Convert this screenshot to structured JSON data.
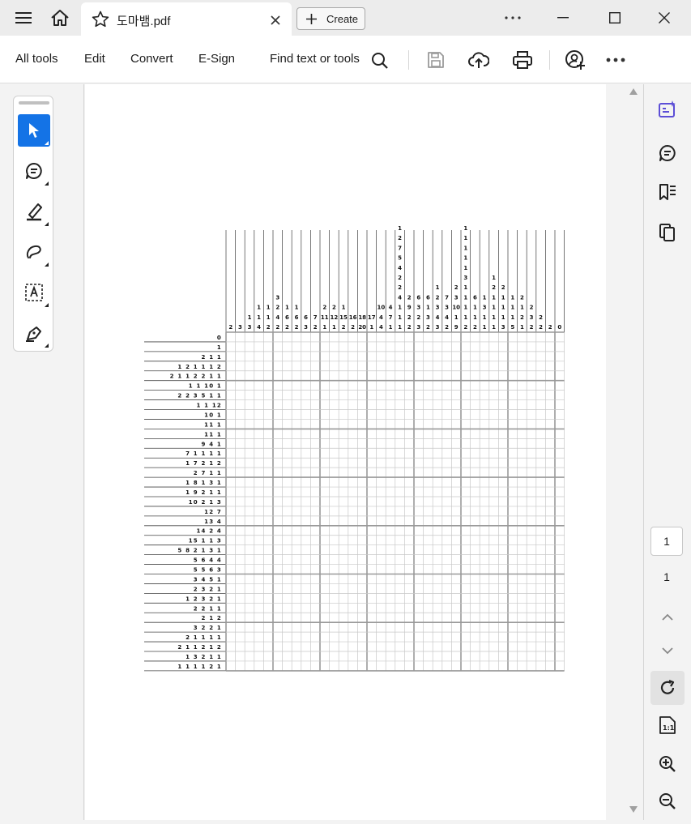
{
  "titlebar": {
    "tab_title": "도마뱀.pdf",
    "create_label": "Create"
  },
  "toolbar": {
    "menu": [
      "All tools",
      "Edit",
      "Convert",
      "E-Sign"
    ],
    "search_label": "Find text or tools"
  },
  "page_nav": {
    "current": "1",
    "total": "1"
  },
  "puzzle": {
    "col_clues": [
      [
        "2"
      ],
      [
        "3"
      ],
      [
        "1",
        "3"
      ],
      [
        "1",
        "1",
        "4"
      ],
      [
        "1",
        "1",
        "2"
      ],
      [
        "3",
        "2",
        "4",
        "2"
      ],
      [
        "1",
        "6",
        "2"
      ],
      [
        "1",
        "6",
        "2"
      ],
      [
        "6",
        "3"
      ],
      [
        "7",
        "2"
      ],
      [
        "2",
        "11",
        "1"
      ],
      [
        "2",
        "12",
        "1"
      ],
      [
        "1",
        "15",
        "2"
      ],
      [
        "16",
        "2"
      ],
      [
        "18",
        "20"
      ],
      [
        "17",
        "1"
      ],
      [
        "10",
        "4",
        "4"
      ],
      [
        "4",
        "7",
        "1"
      ],
      [
        "1",
        "2",
        "7",
        "5",
        "4",
        "2",
        "2",
        "4",
        "1",
        "1",
        "1"
      ],
      [
        "2",
        "9",
        "2",
        "2"
      ],
      [
        "6",
        "3",
        "2",
        "3"
      ],
      [
        "6",
        "1",
        "3",
        "2"
      ],
      [
        "1",
        "2",
        "3",
        "4",
        "3"
      ],
      [
        "7",
        "3",
        "4",
        "2"
      ],
      [
        "2",
        "3",
        "10",
        "1",
        "9"
      ],
      [
        "1",
        "1",
        "1",
        "1",
        "1",
        "3",
        "1",
        "1",
        "1",
        "1",
        "2"
      ],
      [
        "6",
        "1",
        "1",
        "2"
      ],
      [
        "1",
        "3",
        "1",
        "1"
      ],
      [
        "1",
        "2",
        "1",
        "1",
        "1",
        "1"
      ],
      [
        "2",
        "1",
        "1",
        "1",
        "3"
      ],
      [
        "1",
        "1",
        "1",
        "5"
      ],
      [
        "2",
        "1",
        "2",
        "1"
      ],
      [
        "2",
        "3",
        "2"
      ],
      [
        "2",
        "2"
      ],
      [
        "2"
      ],
      [
        "0"
      ]
    ],
    "row_clues": [
      "0",
      "1",
      "2 1 1",
      "1 2 1 1 1 2",
      "2 1 1 2 2 1 1",
      "1 1 10 1",
      "2 2 3 5 1 1",
      "1 1 12",
      "10 1",
      "11 1",
      "11 1",
      "9 4 1",
      "7 1 1 1 1",
      "1 7 2 1 2",
      "2 7 1 1",
      "1 8 1 3 1",
      "1 9 2 1 1",
      "10 2 1 3",
      "12 7",
      "13 4",
      "14 2 4",
      "15 1 1 3",
      "5 8 2 1 3 1",
      "5 6 4 4",
      "5 5 6 3",
      "3 4 5 1",
      "2 3 2 1",
      "1 2 3 2 1",
      "2 2 1 1",
      "2 1 2",
      "3 2 2 1",
      "2 1 1 1 1",
      "2 1 1 2 1 2",
      "1 3 2 1 1",
      "1 1 1 1 2 1"
    ]
  }
}
